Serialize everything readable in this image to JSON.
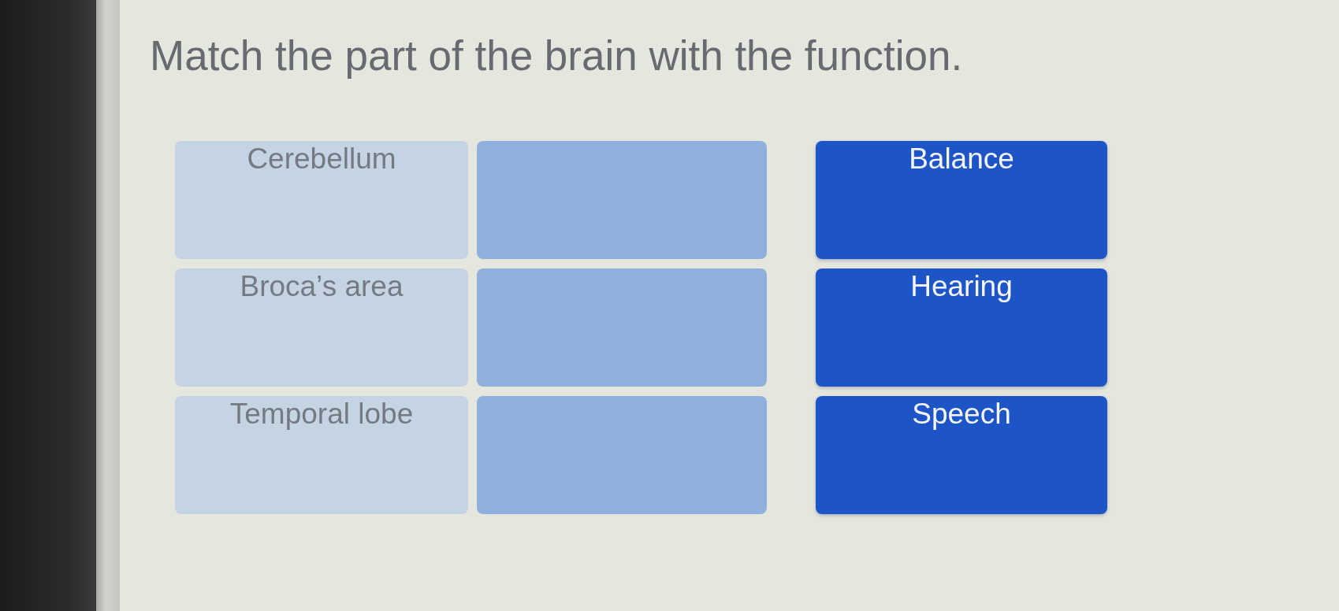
{
  "question": "Match the part of the brain with the function.",
  "terms": [
    {
      "label": "Cerebellum"
    },
    {
      "label": "Broca’s area"
    },
    {
      "label": "Temporal lobe"
    }
  ],
  "answers": [
    {
      "label": "Balance"
    },
    {
      "label": "Hearing"
    },
    {
      "label": "Speech"
    }
  ]
}
